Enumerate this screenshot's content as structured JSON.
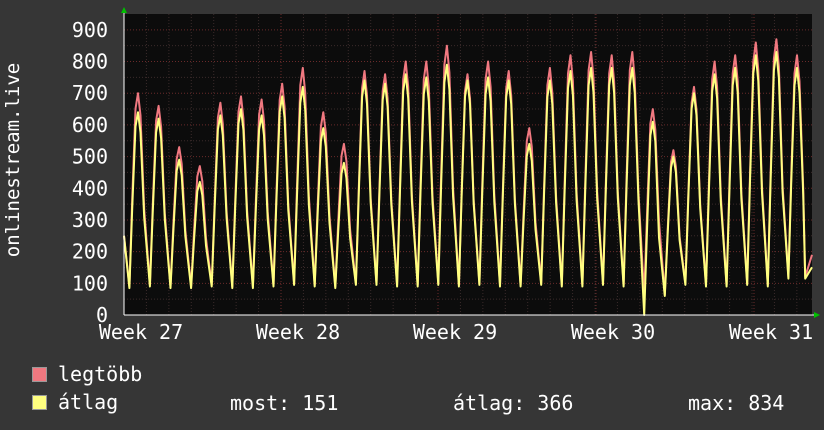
{
  "chart_data": {
    "type": "line",
    "ylabel": "onlinestream.live",
    "ylim": [
      0,
      950
    ],
    "yticks": [
      0,
      100,
      200,
      300,
      400,
      500,
      600,
      700,
      800,
      900
    ],
    "xticks": [
      "Week 27",
      "Week 28",
      "Week 29",
      "Week 30",
      "Week 31"
    ],
    "grid": true,
    "days": [
      "d1",
      "d2",
      "d3",
      "d4",
      "d5",
      "d6",
      "d7",
      "d8",
      "d9",
      "d10",
      "d11",
      "d12",
      "d13",
      "d14",
      "d15",
      "d16",
      "d17",
      "d18",
      "d19",
      "d20",
      "d21",
      "d22",
      "d23",
      "d24",
      "d25",
      "d26",
      "d27",
      "d28",
      "d29",
      "d30",
      "d31",
      "d32",
      "d33",
      "d34",
      "d35"
    ],
    "series": [
      {
        "name": "legtöbb",
        "color": "#f07880",
        "peaks": [
          700,
          660,
          530,
          470,
          670,
          690,
          680,
          730,
          780,
          640,
          540,
          770,
          760,
          800,
          800,
          850,
          760,
          800,
          770,
          590,
          780,
          820,
          830,
          820,
          830,
          650,
          520,
          720,
          800,
          820,
          860,
          870,
          820
        ],
        "troughs": [
          90,
          95,
          90,
          90,
          95,
          90,
          90,
          95,
          100,
          95,
          90,
          100,
          100,
          95,
          95,
          100,
          95,
          100,
          95,
          95,
          100,
          95,
          95,
          100,
          95,
          60,
          65,
          100,
          95,
          95,
          100,
          95,
          120
        ]
      },
      {
        "name": "átlag",
        "color": "#ffff80",
        "peaks": [
          640,
          620,
          490,
          420,
          630,
          650,
          630,
          690,
          720,
          590,
          480,
          740,
          730,
          760,
          750,
          790,
          740,
          750,
          740,
          540,
          740,
          770,
          780,
          780,
          780,
          610,
          500,
          700,
          760,
          780,
          820,
          830,
          780
        ],
        "troughs": [
          85,
          90,
          85,
          85,
          90,
          85,
          85,
          90,
          95,
          90,
          85,
          95,
          95,
          90,
          90,
          95,
          90,
          95,
          90,
          90,
          95,
          90,
          90,
          95,
          90,
          0,
          60,
          95,
          90,
          90,
          95,
          90,
          115
        ]
      }
    ],
    "legend": [
      {
        "label": "legtöbb",
        "color": "#f07880"
      },
      {
        "label": "átlag",
        "color": "#ffff80"
      }
    ],
    "stats": {
      "current": "most: 151",
      "average": "átlag: 366",
      "maximum": "max: 834"
    }
  },
  "colors": {
    "background": "#363636",
    "plot_background": "#0c0c0c",
    "grid_minor": "#3a2a2a",
    "grid_major": "#6a2a2a",
    "axis_arrow": "#00c000"
  }
}
